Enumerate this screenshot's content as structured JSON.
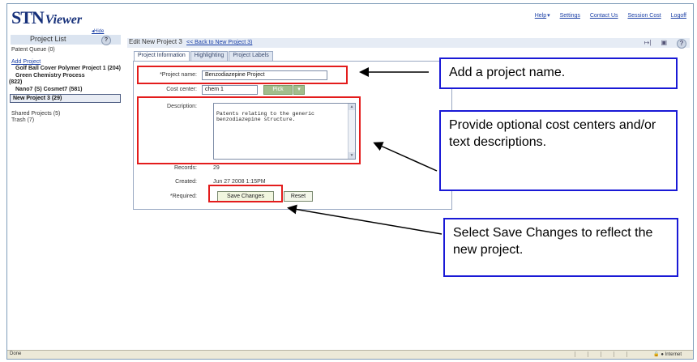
{
  "app": {
    "logo_main": "STN",
    "logo_sub": "Viewer"
  },
  "top_links": [
    "Help",
    "Settings",
    "Contact Us",
    "Session Cost",
    "Logoff"
  ],
  "sidebar": {
    "hide_label": "Hide",
    "title": "Project List",
    "patent_queue": "Patent Queue (0)",
    "add_project": "Add Project",
    "projects": [
      "Golf Ball Cover Polymer Project 1 (204)",
      "Green Chemistry Process (822)",
      "Nano7 (S) Cosmet7 (581)"
    ],
    "selected_project": "New Project 3 (29)",
    "shared": "Shared Projects (5)",
    "trash": "Trash (7)"
  },
  "main": {
    "title": "Edit New Project 3",
    "back_link": "<< Back to New Project 3)",
    "tabs": [
      "Project Information",
      "Highlighting",
      "Project Labels"
    ]
  },
  "form": {
    "project_name_label": "*Project name:",
    "project_name_value": "Benzodiazepine Project",
    "cost_center_label": "Cost center:",
    "cost_center_value": "chem 1",
    "pick_label": "Pick",
    "description_label": "Description:",
    "description_value": "Patents relating to the generic benzodiazepine structure.",
    "records_label": "Records:",
    "records_value": "29",
    "created_label": "Created:",
    "created_value": "Jun 27 2008 1:15PM",
    "required_label": "*Required:",
    "save_label": "Save Changes",
    "reset_label": "Reset"
  },
  "callouts": {
    "name": "Add a project name.",
    "desc": "Provide optional cost centers and/or text descriptions.",
    "save": "Select Save Changes to reflect the new project."
  },
  "statusbar": {
    "left": "Done",
    "zone": "Internet"
  }
}
